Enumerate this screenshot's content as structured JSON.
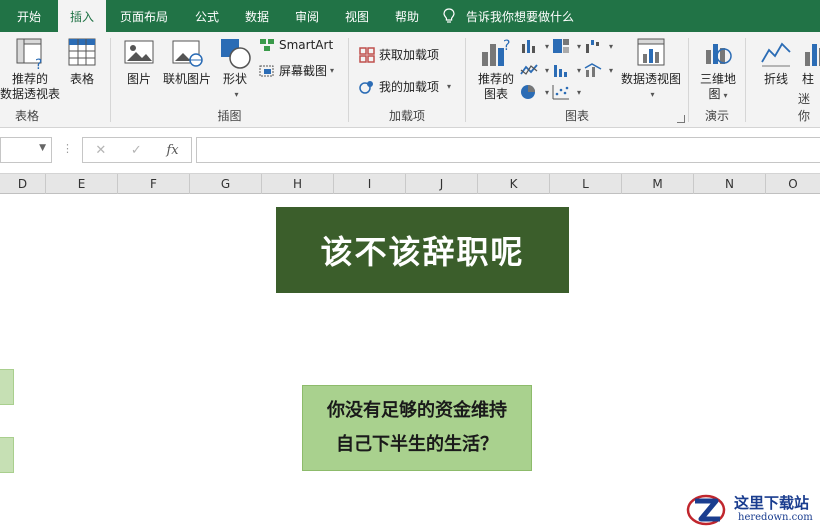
{
  "tabs": [
    {
      "label": "开始",
      "active": false
    },
    {
      "label": "插入",
      "active": true
    },
    {
      "label": "页面布局",
      "active": false
    },
    {
      "label": "公式",
      "active": false
    },
    {
      "label": "数据",
      "active": false
    },
    {
      "label": "审阅",
      "active": false
    },
    {
      "label": "视图",
      "active": false
    },
    {
      "label": "帮助",
      "active": false
    }
  ],
  "tell_me": "告诉我你想要做什么",
  "ribbon": {
    "tables": {
      "label": "表格",
      "recommended_pivot_line1": "推荐的",
      "recommended_pivot_line2": "数据透视表",
      "table": "表格"
    },
    "illustrations": {
      "label": "插图",
      "pictures": "图片",
      "online_pictures": "联机图片",
      "shapes": "形状",
      "smartart": "SmartArt",
      "screenshot": "屏幕截图"
    },
    "addins": {
      "label": "加载项",
      "get_addins": "获取加载项",
      "my_addins": "我的加载项"
    },
    "charts": {
      "label": "图表",
      "recommended_charts_line1": "推荐的",
      "recommended_charts_line2": "图表",
      "pivot_chart": "数据透视图"
    },
    "tours": {
      "label": "演示",
      "map3d_line1": "三维地",
      "map3d_line2": "图"
    },
    "sparklines": {
      "label": "迷你",
      "line": "折线",
      "column": "柱"
    }
  },
  "formula_bar": {
    "name_box": "",
    "cancel": "✕",
    "enter": "✓",
    "fx": "fx",
    "content": ""
  },
  "columns": [
    "D",
    "E",
    "F",
    "G",
    "H",
    "I",
    "J",
    "K",
    "L",
    "M",
    "N",
    "O"
  ],
  "sheet": {
    "title": "该不该辞职呢",
    "question_line1": "你没有足够的资金维持",
    "question_line2": "自己下半生的生活？"
  },
  "watermark": {
    "brand": "这里下载站",
    "url": "heredown.com"
  },
  "colors": {
    "ribbon_green": "#217346",
    "title_bg": "#3b5e2b",
    "question_bg": "#a9d18e"
  }
}
